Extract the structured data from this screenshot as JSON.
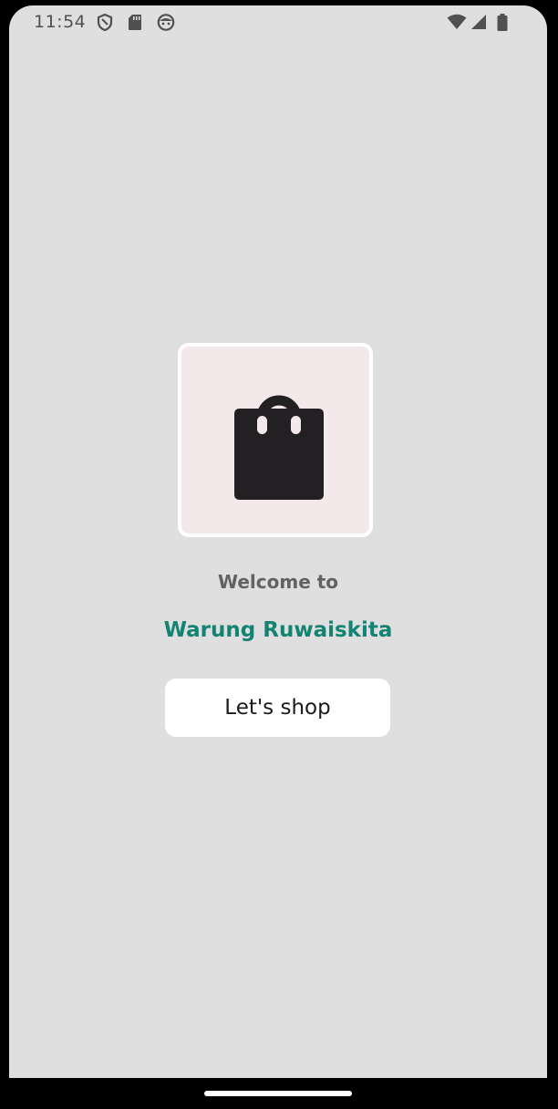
{
  "status_bar": {
    "time": "11:54",
    "left_icons": [
      "shield-icon",
      "sd-card-icon",
      "android-face-icon"
    ],
    "right_icons": [
      "wifi-icon",
      "cell-signal-icon",
      "battery-icon"
    ]
  },
  "splash": {
    "logo_icon": "shopping-bag-icon",
    "welcome_label": "Welcome to",
    "store_name": "Warung Ruwaiskita",
    "cta_label": "Let's shop"
  },
  "colors": {
    "background": "#dfdfdf",
    "logo_bg": "#f4e9ea",
    "brand_teal": "#138373",
    "welcome_gray": "#626262",
    "button_bg": "#ffffff"
  }
}
